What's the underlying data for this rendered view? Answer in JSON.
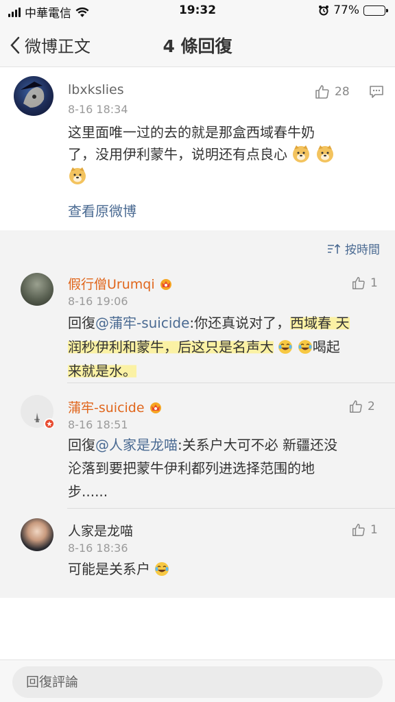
{
  "status_bar": {
    "carrier": "中華電信",
    "time": "19:32",
    "battery": "77%",
    "battery_level": 0.77
  },
  "nav": {
    "back_label": "微博正文",
    "title": "4 條回復"
  },
  "main_comment": {
    "username": "lbxkslies",
    "time": "8-16 18:34",
    "likes": "28",
    "text_line1": "这里面唯一过的去的就是那盒西域春牛奶",
    "text_line2": "了，没用伊利蒙牛，说明还有点良心",
    "emoji": "doge",
    "view_original": "查看原微博"
  },
  "sort_label": "按時間",
  "replies": [
    {
      "username": "假行僧Urumqi",
      "time": "8-16 19:06",
      "likes": "1",
      "prefix": "回復",
      "mention": "@蒲牢-suicide",
      "text_a": ":你还真说对了，",
      "text_b": "西域春 天",
      "text_line2": "润秒伊利和蒙牛，后这只是名声大",
      "text_line2_end": "喝起",
      "text_line3": "来就是水。",
      "emoji": "laughing-tears"
    },
    {
      "username": "蒲牢-suicide",
      "time": "8-16 18:51",
      "likes": "2",
      "prefix": "回復",
      "mention": "@人家是龙喵",
      "text_line1": ":关系户大可不必 新疆还没",
      "text_line2": "沦落到要把蒙牛伊利都列进选择范围的地",
      "text_line3": "步......"
    },
    {
      "username": "人家是龙喵",
      "time": "8-16 18:36",
      "likes": "1",
      "text": "可能是关系户",
      "emoji": "laughing-tears"
    }
  ],
  "bottom": {
    "placeholder": "回復評論"
  },
  "colors": {
    "link": "#4a6a92",
    "vip_name": "#e0661c",
    "highlight": "#fcf196"
  }
}
